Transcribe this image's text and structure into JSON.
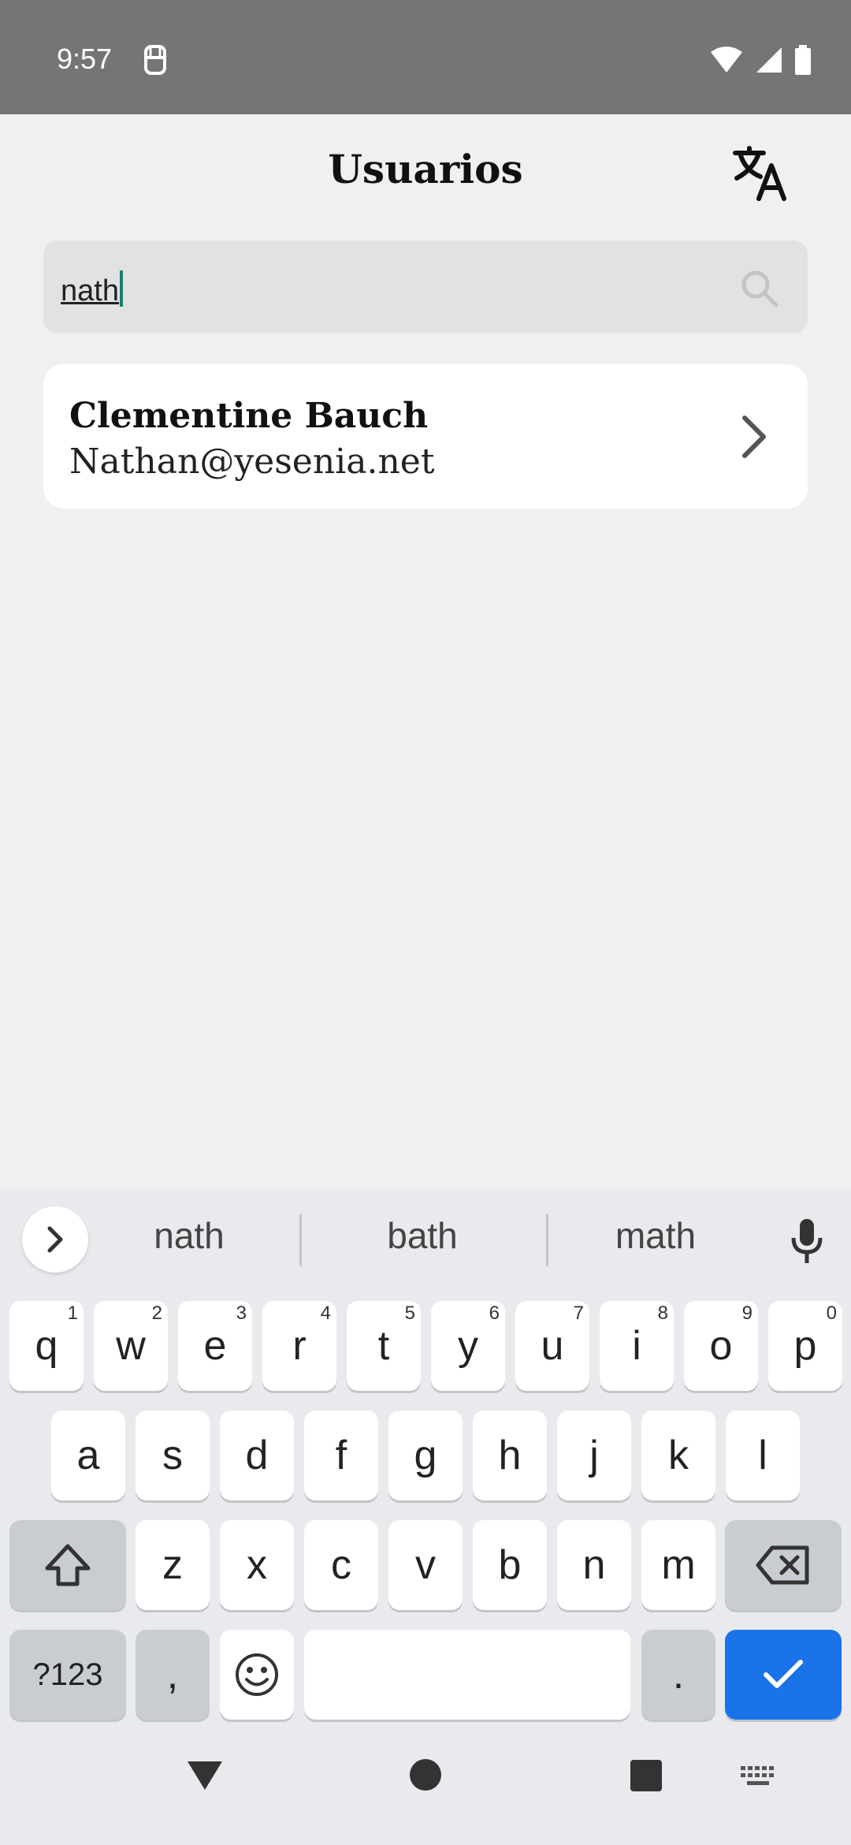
{
  "status_bar": {
    "time": "9:57"
  },
  "header": {
    "title": "Usuarios"
  },
  "search": {
    "value": "nath"
  },
  "results": [
    {
      "name": "Clementine Bauch",
      "email": "Nathan@yesenia.net"
    }
  ],
  "keyboard": {
    "suggestions": [
      "nath",
      "bath",
      "math"
    ],
    "row1": [
      {
        "key": "q",
        "hint": "1"
      },
      {
        "key": "w",
        "hint": "2"
      },
      {
        "key": "e",
        "hint": "3"
      },
      {
        "key": "r",
        "hint": "4"
      },
      {
        "key": "t",
        "hint": "5"
      },
      {
        "key": "y",
        "hint": "6"
      },
      {
        "key": "u",
        "hint": "7"
      },
      {
        "key": "i",
        "hint": "8"
      },
      {
        "key": "o",
        "hint": "9"
      },
      {
        "key": "p",
        "hint": "0"
      }
    ],
    "row2": [
      "a",
      "s",
      "d",
      "f",
      "g",
      "h",
      "j",
      "k",
      "l"
    ],
    "row3": [
      "z",
      "x",
      "c",
      "v",
      "b",
      "n",
      "m"
    ],
    "symbols_label": "?123",
    "comma": ",",
    "period": "."
  },
  "colors": {
    "accent": "#1a73e8",
    "status_bar": "#757575",
    "background": "#f0f0f0"
  }
}
